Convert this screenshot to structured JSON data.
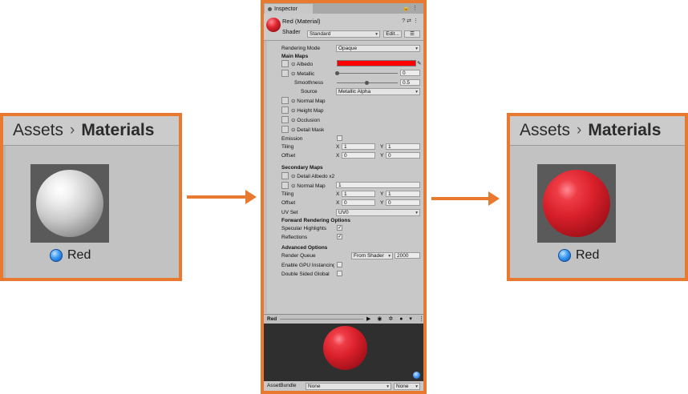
{
  "left_panel": {
    "breadcrumb": {
      "parent": "Assets",
      "separator": "›",
      "current": "Materials"
    },
    "asset_name": "Red",
    "sphere_color": "#e8e8e8"
  },
  "right_panel": {
    "breadcrumb": {
      "parent": "Assets",
      "separator": "›",
      "current": "Materials"
    },
    "asset_name": "Red",
    "sphere_color": "#d9202b"
  },
  "accent_color": "#e8792e",
  "inspector": {
    "tab_title": "Inspector",
    "material_name": "Red (Material)",
    "shader_label": "Shader",
    "shader_value": "Standard",
    "edit_button": "Edit...",
    "list_button": "☰",
    "rendering_mode_label": "Rendering Mode",
    "rendering_mode_value": "Opaque",
    "main_maps_heading": "Main Maps",
    "albedo_label": "Albedo",
    "albedo_color": "#ff0000",
    "metallic_label": "Metallic",
    "metallic_value": "0",
    "smoothness_label": "Smoothness",
    "smoothness_value": "0.5",
    "source_label": "Source",
    "source_value": "Metallic Alpha",
    "normal_map_label": "Normal Map",
    "height_map_label": "Height Map",
    "occlusion_label": "Occlusion",
    "detail_mask_label": "Detail Mask",
    "emission_label": "Emission",
    "tiling_label": "Tiling",
    "offset_label": "Offset",
    "x_label": "X",
    "y_label": "Y",
    "main_tiling_x": "1",
    "main_tiling_y": "1",
    "main_offset_x": "0",
    "main_offset_y": "0",
    "secondary_maps_heading": "Secondary Maps",
    "detail_albedo_label": "Detail Albedo x2",
    "secondary_normal_label": "Normal Map",
    "secondary_normal_value": "1",
    "sec_tiling_x": "1",
    "sec_tiling_y": "1",
    "sec_offset_x": "0",
    "sec_offset_y": "0",
    "uv_set_label": "UV Set",
    "uv_set_value": "UV0",
    "forward_heading": "Forward Rendering Options",
    "specular_label": "Specular Highlights",
    "reflections_label": "Reflections",
    "advanced_heading": "Advanced Options",
    "render_queue_label": "Render Queue",
    "render_queue_mode": "From Shader",
    "render_queue_value": "2000",
    "gpu_instancing_label": "Enable GPU Instancing",
    "double_sided_label": "Double Sided Global",
    "preview_title": "Red",
    "asset_bundle_label": "AssetBundle",
    "asset_bundle_value": "None",
    "asset_bundle_variant": "None"
  }
}
